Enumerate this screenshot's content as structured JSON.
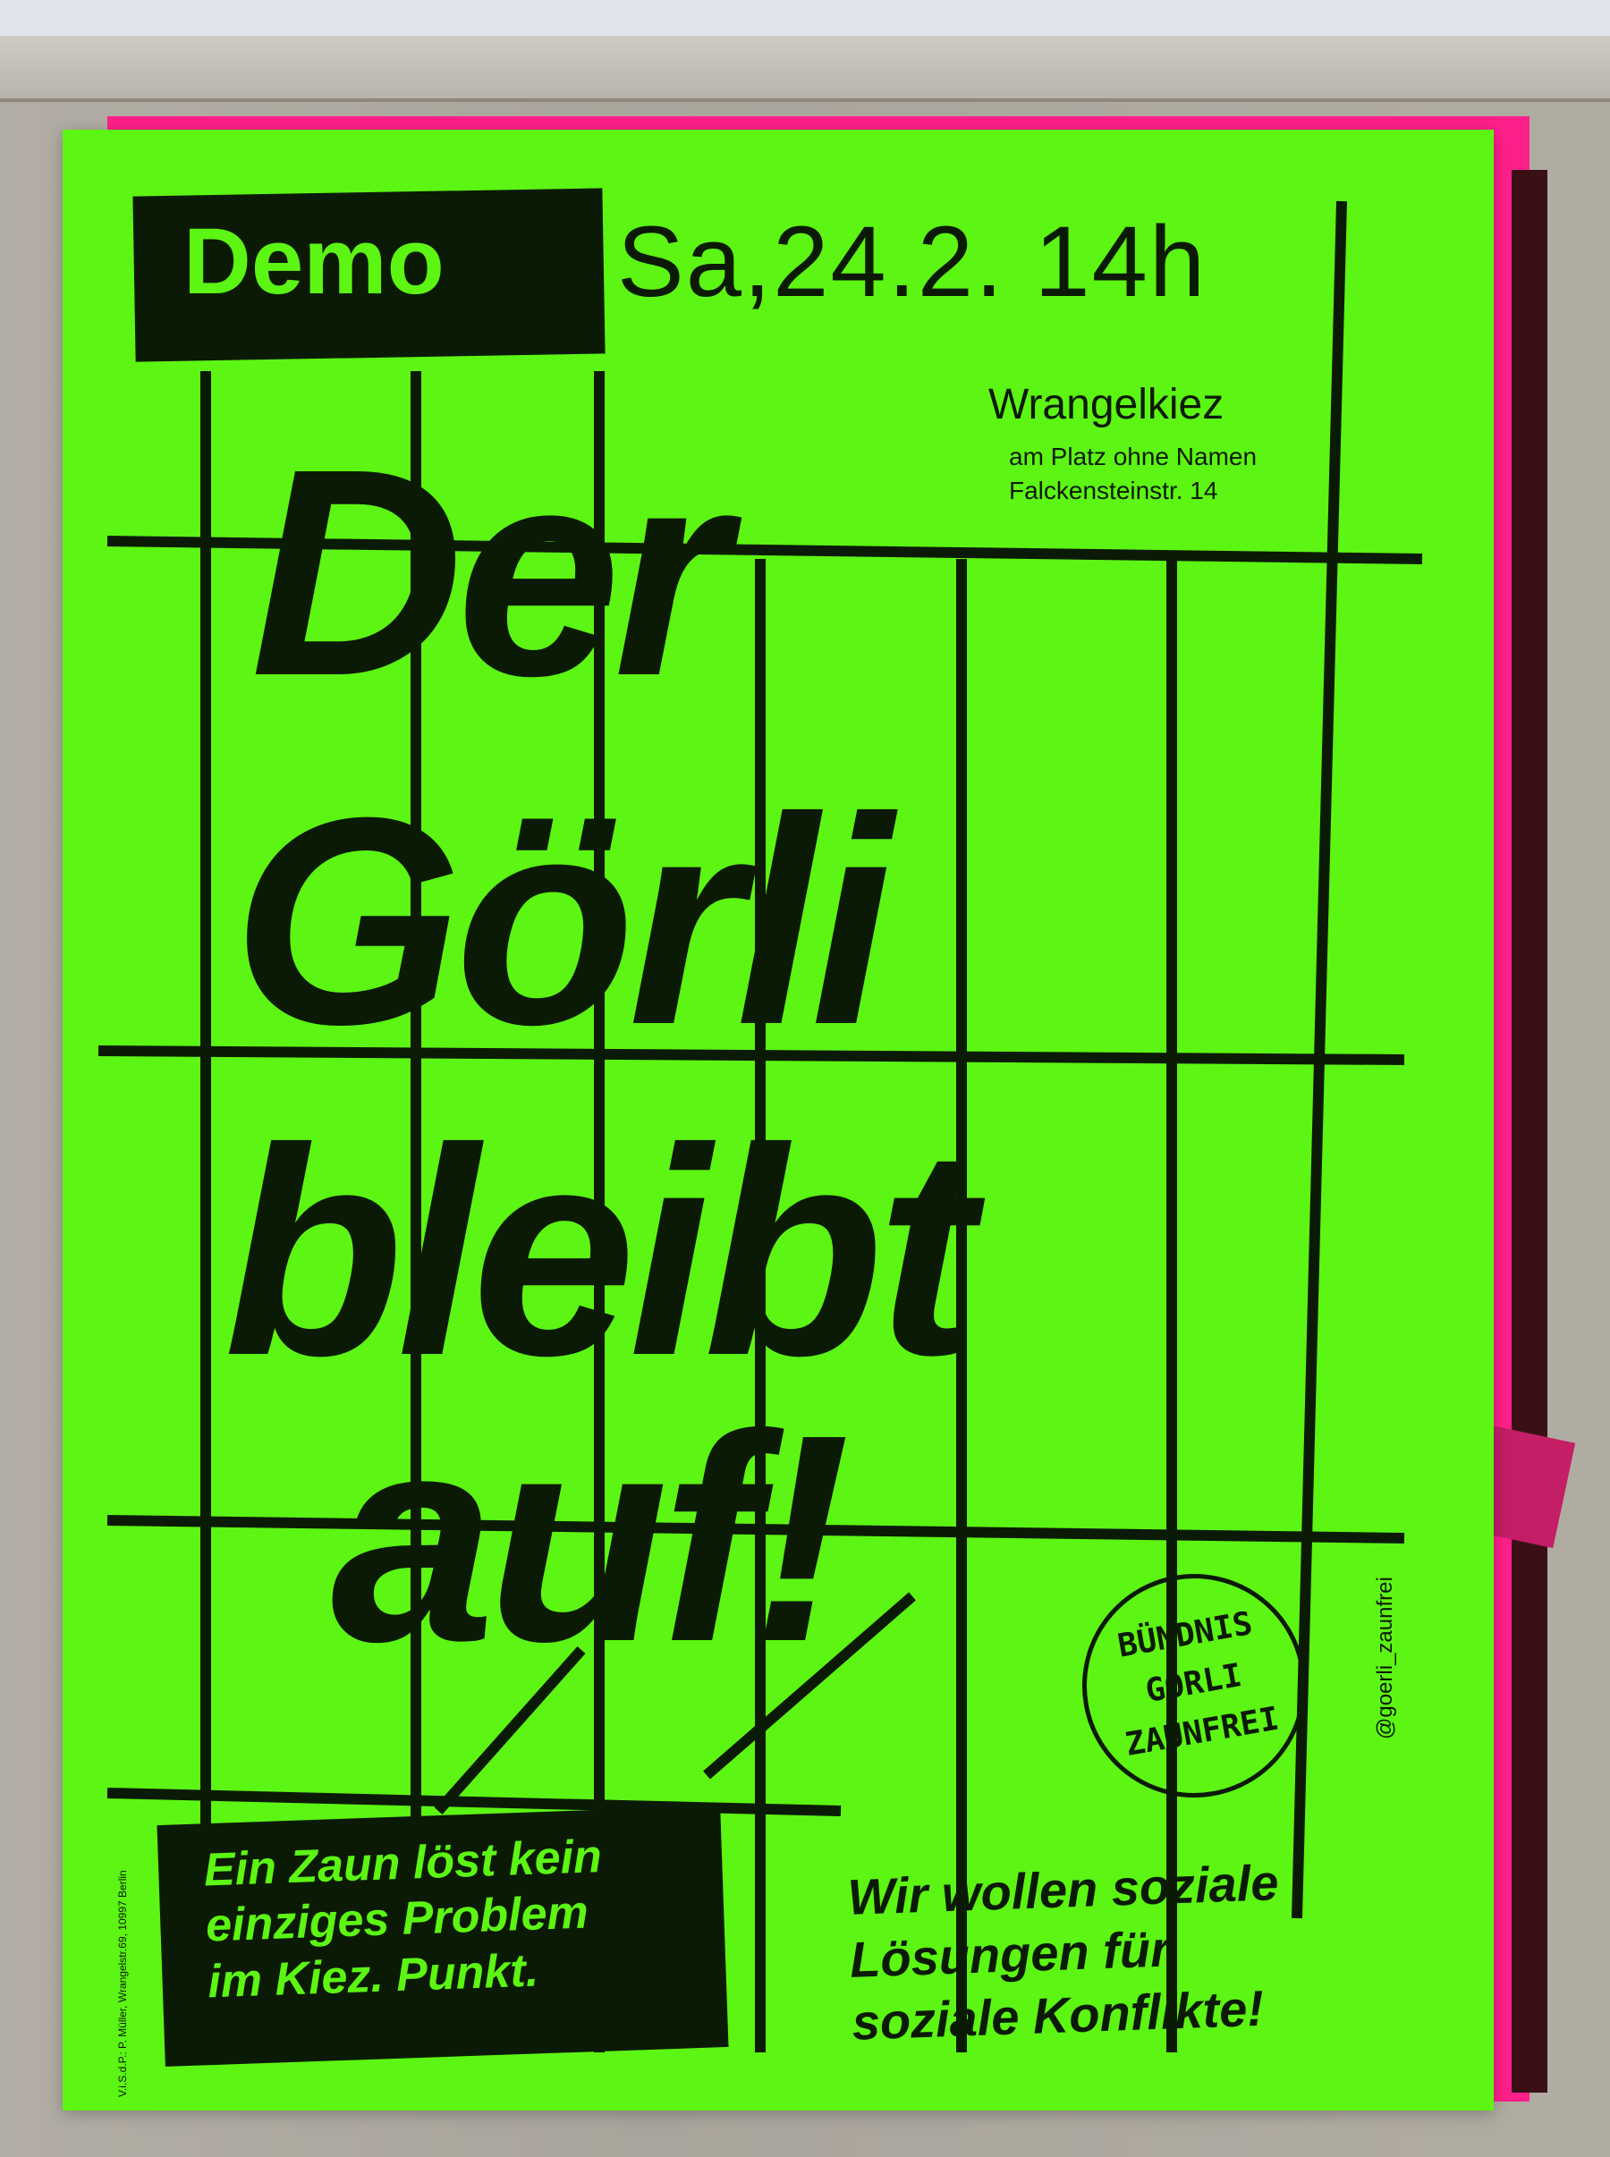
{
  "poster": {
    "demo_label": "Demo",
    "date_time": "Sa,24.2. 14h",
    "location": {
      "district": "Wrangelkiez",
      "place": "am Platz ohne Namen",
      "address": "Falckensteinstr. 14"
    },
    "headline": [
      "Der",
      "Görli",
      "bleibt",
      "auf!"
    ],
    "slogan_left": [
      "Ein Zaun löst kein",
      "einziges Problem",
      "im Kiez. Punkt."
    ],
    "slogan_right": [
      "Wir wollen soziale",
      "Lösungen für",
      "soziale Konflikte!"
    ],
    "stamp_lines": [
      "BÜNDNIS",
      "GÖRLI",
      "ZAUNFREI"
    ],
    "social_handle": "@goerli_zaunfrei",
    "imprint": "V.i.S.d.P.: P. Müller, Wrangelstr.69, 10997 Berlin"
  },
  "colors": {
    "poster_green": "#5cf514",
    "ink": "#0b1a05",
    "pink": "#ff1f8a",
    "wall": "#aaa59c"
  }
}
